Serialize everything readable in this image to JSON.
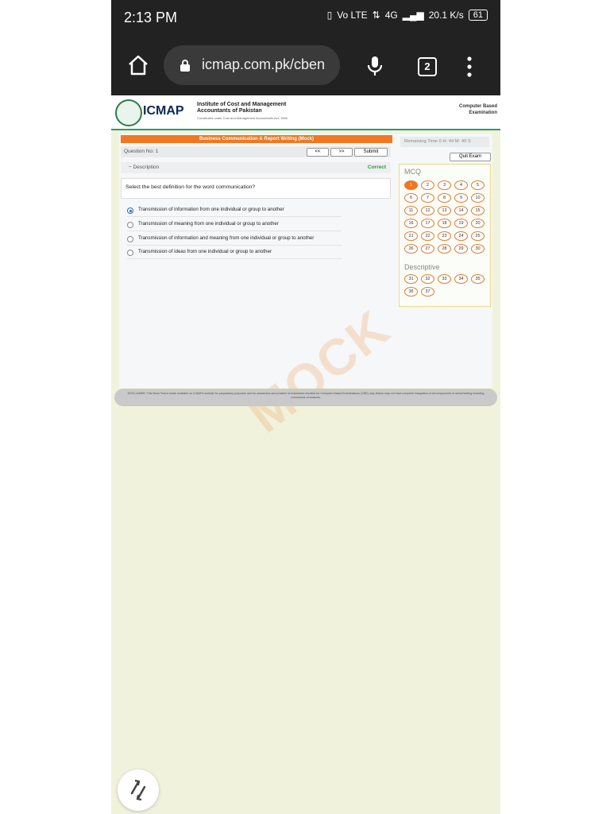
{
  "status_bar": {
    "time": "2:13 PM",
    "signal_text": "Vo LTE",
    "network": "4G",
    "speed": "20.1 K/s",
    "battery": "61"
  },
  "browser": {
    "url": "icmap.com.pk/cben",
    "tab_count": "2"
  },
  "header": {
    "logo": "ICMAP",
    "institute_name": "Institute of Cost and Management Accountants of Pakistan",
    "constituted": "Constituted under Cost and Management Accountants Act, 1966",
    "cbe": "Computer Based Examination"
  },
  "exam": {
    "course_title": "Business Communication & Report Writing (Mock)",
    "question_no": "Question No: 1",
    "prev_label": "<<",
    "next_label": ">>",
    "submit_label": "Submit",
    "description_label": "− Description",
    "status": "Correct",
    "question": "Select the best definition for the word communication?",
    "options": [
      {
        "text": "Transmission of information from one individual or group to another",
        "selected": true
      },
      {
        "text": "Transmission of meaning from one individual or group to another",
        "selected": false
      },
      {
        "text": "Transmission of information and meaning from one individual or group to another",
        "selected": false
      },
      {
        "text": "Transmission of ideas from one individual or group to another",
        "selected": false
      }
    ],
    "remaining_time": "Remaining Time 0 H: 44 M: 40 S",
    "quit_label": "Quit Exam"
  },
  "question_panel": {
    "mcq_heading": "MCQ",
    "mcq_numbers": [
      "1",
      "2",
      "3",
      "4",
      "5",
      "6",
      "7",
      "8",
      "9",
      "10",
      "11",
      "12",
      "13",
      "14",
      "15",
      "16",
      "17",
      "18",
      "19",
      "20",
      "21",
      "22",
      "23",
      "24",
      "25",
      "26",
      "27",
      "28",
      "29",
      "30"
    ],
    "active": "1",
    "descriptive_heading": "Descriptive",
    "descriptive_numbers": [
      "31",
      "32",
      "33",
      "34",
      "35",
      "36",
      "37"
    ]
  },
  "watermark": "MOCK",
  "disclaimer": "DISCLAIMER: This Mock Test is made available on ICMAPs website for preparatory purposes and for awareness and practice of examinees enrolled for Computer Based Examinations (CBE) only. Below may not have complete integration of all components of actual testing including correctness of answers."
}
